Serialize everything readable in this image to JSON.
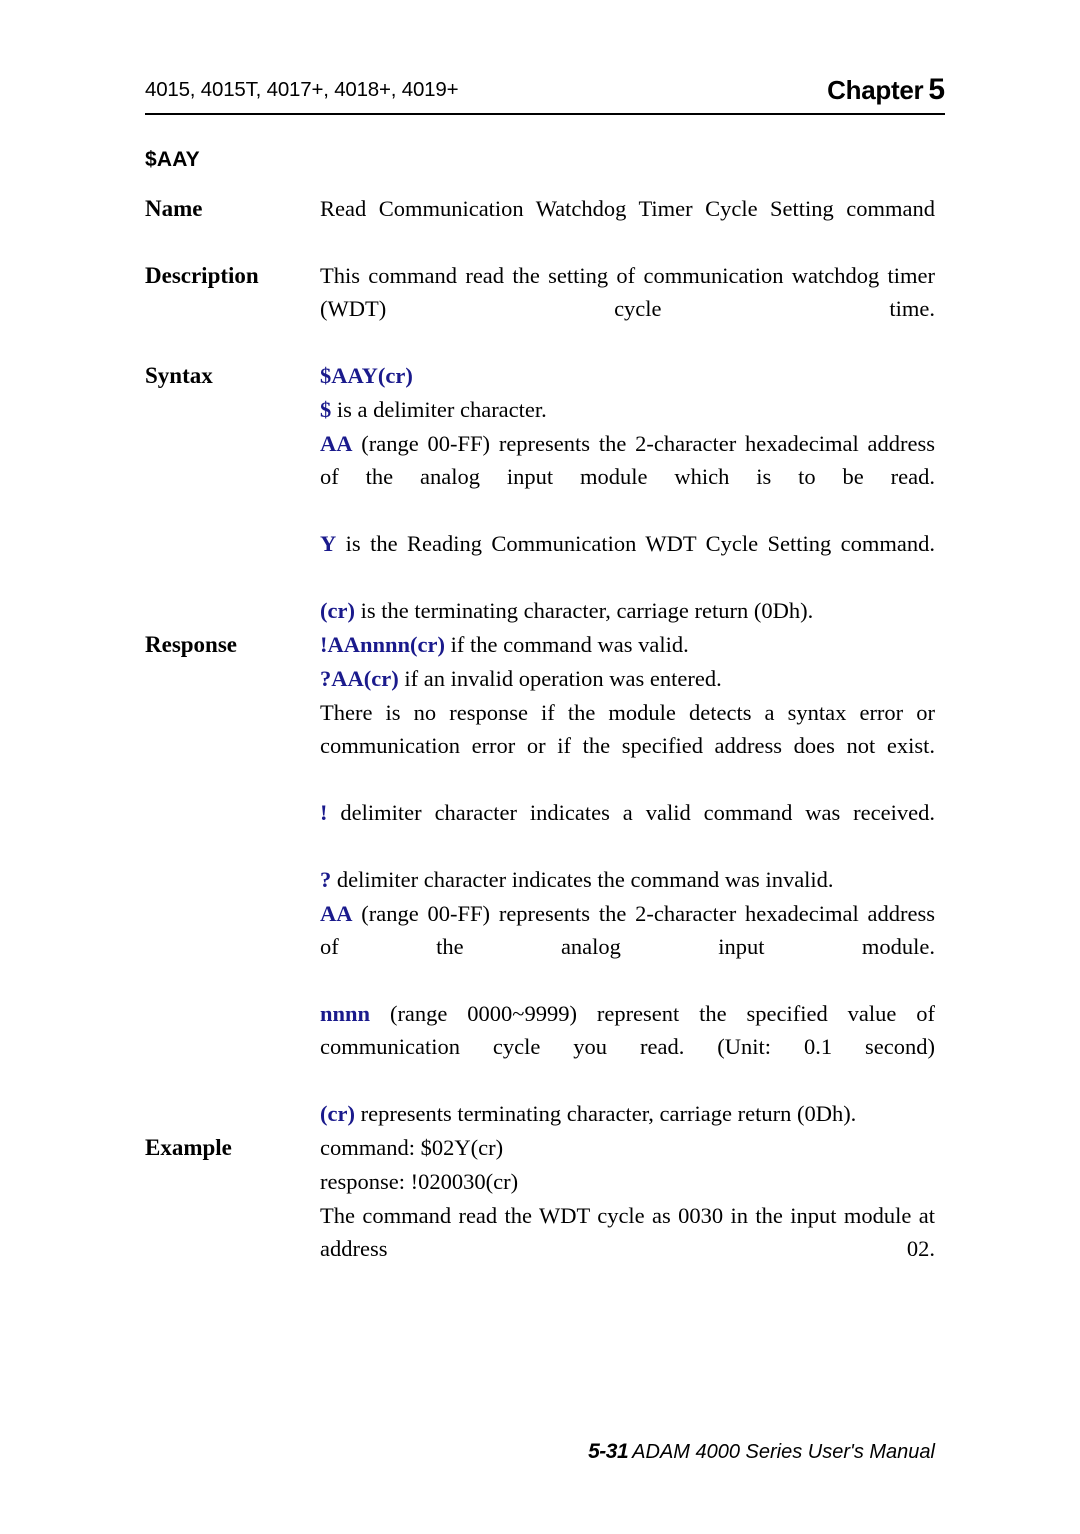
{
  "header": {
    "models": "4015, 4015T, 4017+, 4018+, 4019+",
    "chapter_word": "Chapter",
    "chapter_number": "5"
  },
  "command_title": "$AAY",
  "labels": {
    "name": "Name",
    "description": "Description",
    "syntax": "Syntax",
    "response": "Response",
    "example": "Example"
  },
  "name": {
    "text": "Read Communication Watchdog Timer Cycle Setting command"
  },
  "description": {
    "text": "This command read the setting of communication watchdog timer (WDT) cycle time."
  },
  "syntax": {
    "command": "$AAY(cr)",
    "dollar_token": "$",
    "dollar_desc": " is a delimiter character.",
    "aa_token": "AA",
    "aa_desc": " (range 00-FF) represents the 2-character hexadecimal address of the analog input module which is to be read.",
    "y_token": "Y",
    "y_desc": " is the Reading Communication WDT Cycle Setting command.",
    "cr_token": "(cr)",
    "cr_desc": " is the terminating character, carriage return (0Dh)."
  },
  "response": {
    "valid_token": "!AAnnnn(cr)",
    "valid_desc": " if the command was valid.",
    "invalid_token": "?AA(cr)",
    "invalid_desc": " if an invalid operation was entered.",
    "no_response": "There is no response if the module detects a syntax error or communication error or if the specified address does not exist.",
    "bang_token": "!",
    "bang_desc": " delimiter character indicates a valid command was received.",
    "question_token": "?",
    "question_desc": " delimiter character indicates the command was invalid.",
    "aa_token": "AA",
    "aa_desc": " (range 00-FF) represents the 2-character hexadecimal address of the analog input module.",
    "nnnn_token": "nnnn",
    "nnnn_desc": " (range 0000~9999) represent the specified value of communication cycle you read. (Unit: 0.1 second)",
    "cr_token": "(cr)",
    "cr_desc": " represents terminating character, carriage return (0Dh)."
  },
  "example": {
    "command_line": "command: $02Y(cr)",
    "response_line": "response: !020030(cr)",
    "explanation": "The command read the WDT cycle as 0030 in the input module at address 02."
  },
  "footer": {
    "page": "5-31",
    "manual": "ADAM 4000 Series User's Manual"
  },
  "colors": {
    "token_blue": "#1a1a8c",
    "text_black": "#000000"
  }
}
